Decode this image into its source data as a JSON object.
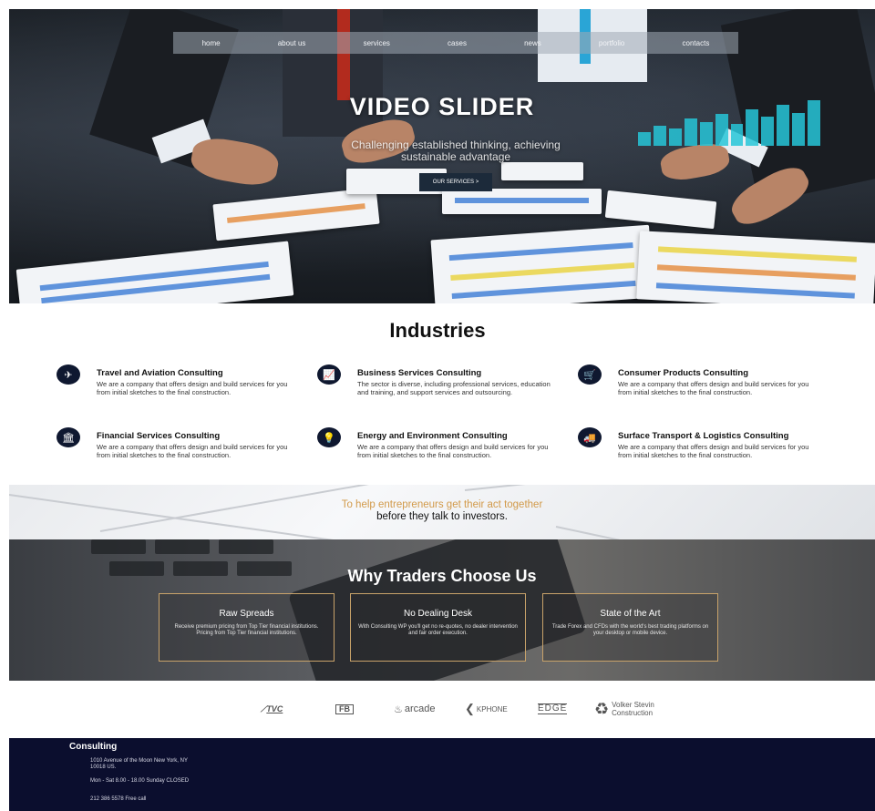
{
  "nav": {
    "items": [
      "home",
      "about us",
      "services",
      "cases",
      "news",
      "portfolio",
      "contacts"
    ]
  },
  "hero": {
    "title": "VIDEO SLIDER",
    "subtitle": "Challenging established thinking, achieving sustainable advantage",
    "button_label": "OUR SERVICES >"
  },
  "industries": {
    "title": "Industries",
    "items": [
      {
        "icon": "airplane-icon",
        "glyph": "✈",
        "name": "Travel and Aviation Consulting",
        "desc": "We are a company that offers design and build services for you from initial sketches to the final construction."
      },
      {
        "icon": "chart-icon",
        "glyph": "📈",
        "name": "Business Services Consulting",
        "desc": "The sector is diverse, including professional services, education and training, and support services and outsourcing."
      },
      {
        "icon": "cart-icon",
        "glyph": "🛒",
        "name": "Consumer Products Consulting",
        "desc": "We are a company that offers design and build services for you from initial sketches to the final construction."
      },
      {
        "icon": "bank-icon",
        "glyph": "🏛",
        "name": "Financial Services Consulting",
        "desc": "We are a company that offers design and build services for you from initial sketches to the final construction."
      },
      {
        "icon": "lightbulb-icon",
        "glyph": "💡",
        "name": "Energy and Environment Consulting",
        "desc": "We are a company that offers design and build services for you from initial sketches to the final construction."
      },
      {
        "icon": "truck-icon",
        "glyph": "🚚",
        "name": "Surface Transport & Logistics Consulting",
        "desc": "We are a company that offers design and build services for you from initial sketches to the final construction."
      }
    ]
  },
  "band": {
    "highlight": "To help entrepreneurs get their act together",
    "rest": "before they talk to investors."
  },
  "why": {
    "title": "Why Traders Choose Us",
    "cards": [
      {
        "title": "Raw Spreads",
        "desc": "Receive premium pricing from Top Tier financial institutions. Pricing from Top Tier financial institutions."
      },
      {
        "title": "No Dealing Desk",
        "desc": "With Consulting WP you'll get no re-quotes, no dealer intervention and fair order execution."
      },
      {
        "title": "State of the Art",
        "desc": "Trade Forex and CFDs with the world's best trading platforms on your desktop or mobile device."
      }
    ]
  },
  "logos": {
    "items": [
      "TVC",
      "FB",
      "arcade",
      "KPHONE",
      "EDGE",
      "Volker Stevin Construction"
    ]
  },
  "footer": {
    "brand": "Consulting",
    "address": "1010 Avenue of the Moon New York, NY 10018 US.",
    "hours": "Mon - Sat 8.00 - 18.00 Sunday CLOSED",
    "phone": "212 386 5578 Free call"
  },
  "colors": {
    "navy": "#0f1830",
    "footer_bg": "#0b0e2e",
    "accent_gold": "#d29a4a",
    "card_border": "#c9a36a"
  }
}
